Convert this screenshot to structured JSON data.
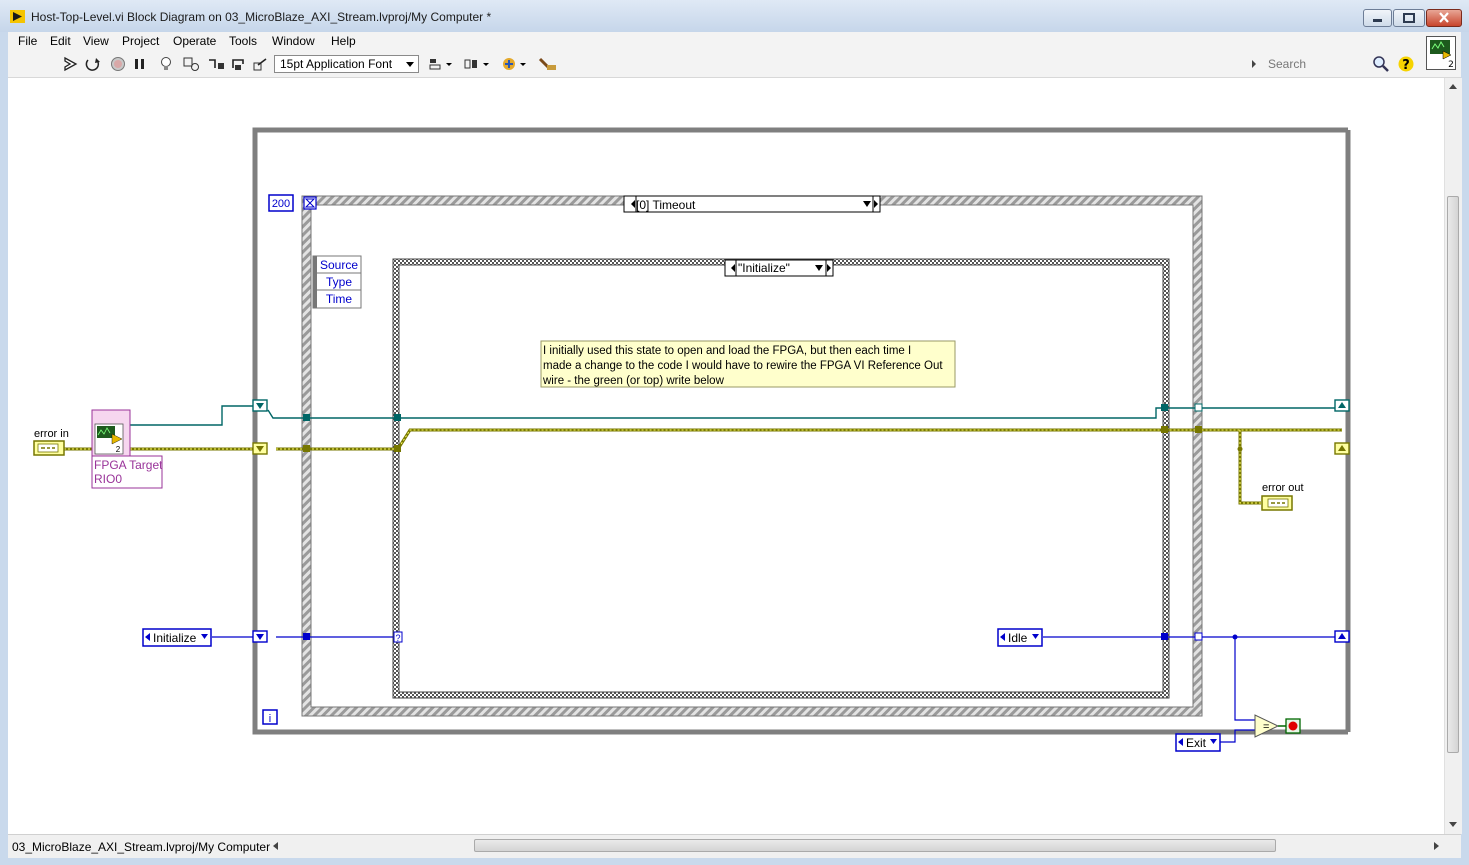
{
  "window": {
    "title": "Host-Top-Level.vi Block Diagram on 03_MicroBlaze_AXI_Stream.lvproj/My Computer *"
  },
  "menu": [
    "File",
    "Edit",
    "View",
    "Project",
    "Operate",
    "Tools",
    "Window",
    "Help"
  ],
  "toolbar": {
    "font": "15pt Application Font",
    "search_placeholder": "Search",
    "icons": [
      "run-arrow-icon",
      "run-continuously-icon",
      "abort-icon",
      "pause-icon",
      "highlight-execution-icon",
      "retain-wire-values-icon",
      "step-into-icon",
      "step-over-icon",
      "step-out-icon",
      "align-icon",
      "distribute-icon",
      "reorder-icon",
      "clean-up-diagram-icon"
    ]
  },
  "diagram": {
    "timeout_constant": "200",
    "event_selector": "[0] Timeout",
    "event_data": [
      "Source",
      "Type",
      "Time"
    ],
    "case_selector": "\"Initialize\"",
    "comment": [
      "I initially used this state to open and load the FPGA, but then each time I",
      "made a change to the code I would have to rewire the FPGA VI Reference Out",
      "wire - the green (or top) write below"
    ],
    "error_in": "error in",
    "error_out": "error out",
    "fpga_target": [
      "FPGA Target",
      "RIO0"
    ],
    "fpga_badge": "2",
    "enum_initialize": "Initialize",
    "enum_idle": "Idle",
    "enum_exit": "Exit",
    "case_terminal": "?",
    "iteration": "i",
    "colors": {
      "error_wire": "#777700",
      "reference_wire": "#006666",
      "enum_wire": "#0000cc",
      "structure_frame": "#7f7f7f",
      "comment_bg": "#ffffcc"
    }
  },
  "status": {
    "context": "03_MicroBlaze_AXI_Stream.lvproj/My Computer"
  }
}
